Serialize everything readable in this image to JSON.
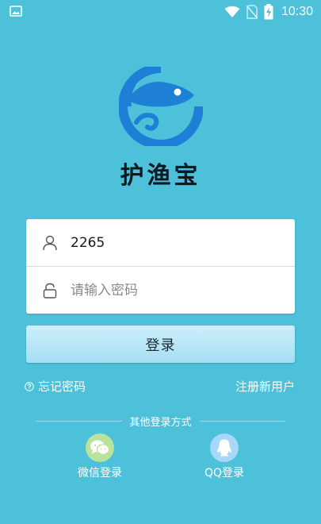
{
  "status_bar": {
    "time": "10:30",
    "icons": [
      "gallery-icon",
      "wifi-icon",
      "no-sim-icon",
      "battery-charging-icon"
    ]
  },
  "brand": {
    "name": "护渔宝",
    "logo_icon": "fish-logo-icon"
  },
  "form": {
    "username": {
      "value": "2265",
      "icon": "user-icon"
    },
    "password": {
      "value": "",
      "placeholder": "请输入密码",
      "icon": "lock-icon"
    }
  },
  "login_button": {
    "label": "登录"
  },
  "links": {
    "forgot_password": "忘记密码",
    "register": "注册新用户"
  },
  "other_login": {
    "title": "其他登录方式",
    "wechat": {
      "label": "微信登录",
      "icon": "wechat-icon"
    },
    "qq": {
      "label": "QQ登录",
      "icon": "qq-icon"
    }
  },
  "colors": {
    "background": "#4cc1d9",
    "logo_blue": "#1d7fd6",
    "wechat_bg": "#b9e29c",
    "qq_bg": "#a8d8f7"
  }
}
